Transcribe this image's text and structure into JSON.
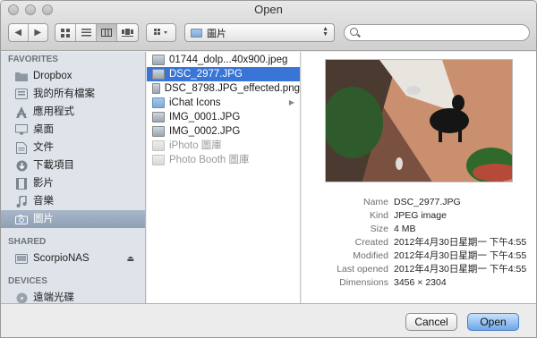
{
  "window": {
    "title": "Open"
  },
  "toolbar": {
    "path_popup_label": "圖片",
    "search_placeholder": ""
  },
  "sidebar": {
    "sections": [
      {
        "header": "FAVORITES",
        "items": [
          {
            "label": "Dropbox",
            "icon": "folder-icon"
          },
          {
            "label": "我的所有檔案",
            "icon": "all-files-icon"
          },
          {
            "label": "應用程式",
            "icon": "applications-icon"
          },
          {
            "label": "桌面",
            "icon": "desktop-icon"
          },
          {
            "label": "文件",
            "icon": "documents-icon"
          },
          {
            "label": "下載項目",
            "icon": "downloads-icon"
          },
          {
            "label": "影片",
            "icon": "movies-icon"
          },
          {
            "label": "音樂",
            "icon": "music-icon"
          },
          {
            "label": "圖片",
            "icon": "pictures-icon",
            "selected": true
          }
        ]
      },
      {
        "header": "SHARED",
        "items": [
          {
            "label": "ScorpioNAS",
            "icon": "server-icon",
            "eject": true
          }
        ]
      },
      {
        "header": "DEVICES",
        "items": [
          {
            "label": "遠端光碟",
            "icon": "disc-icon"
          }
        ]
      }
    ]
  },
  "files": [
    {
      "name": "01744_dolp...40x900.jpeg",
      "type": "image"
    },
    {
      "name": "DSC_2977.JPG",
      "type": "image",
      "selected": true
    },
    {
      "name": "DSC_8798.JPG_effected.png",
      "type": "image"
    },
    {
      "name": "iChat Icons",
      "type": "folder",
      "chevron": true
    },
    {
      "name": "IMG_0001.JPG",
      "type": "image"
    },
    {
      "name": "IMG_0002.JPG",
      "type": "image"
    },
    {
      "name": "iPhoto 圖庫",
      "type": "app",
      "dim": true
    },
    {
      "name": "Photo Booth 圖庫",
      "type": "app",
      "dim": true
    }
  ],
  "preview": {
    "info": [
      {
        "key": "Name",
        "value": "DSC_2977.JPG"
      },
      {
        "key": "Kind",
        "value": "JPEG image"
      },
      {
        "key": "Size",
        "value": "4 MB"
      },
      {
        "key": "Created",
        "value": "2012年4月30日星期一 下午4:55"
      },
      {
        "key": "Modified",
        "value": "2012年4月30日星期一 下午4:55"
      },
      {
        "key": "Last opened",
        "value": "2012年4月30日星期一 下午4:55"
      },
      {
        "key": "Dimensions",
        "value": "3456 × 2304"
      }
    ]
  },
  "buttons": {
    "cancel": "Cancel",
    "open": "Open"
  },
  "colors": {
    "selection": "#3875d7",
    "sidebar_bg": "#dfe4ea",
    "sidebar_selected": "#9aaabd"
  }
}
